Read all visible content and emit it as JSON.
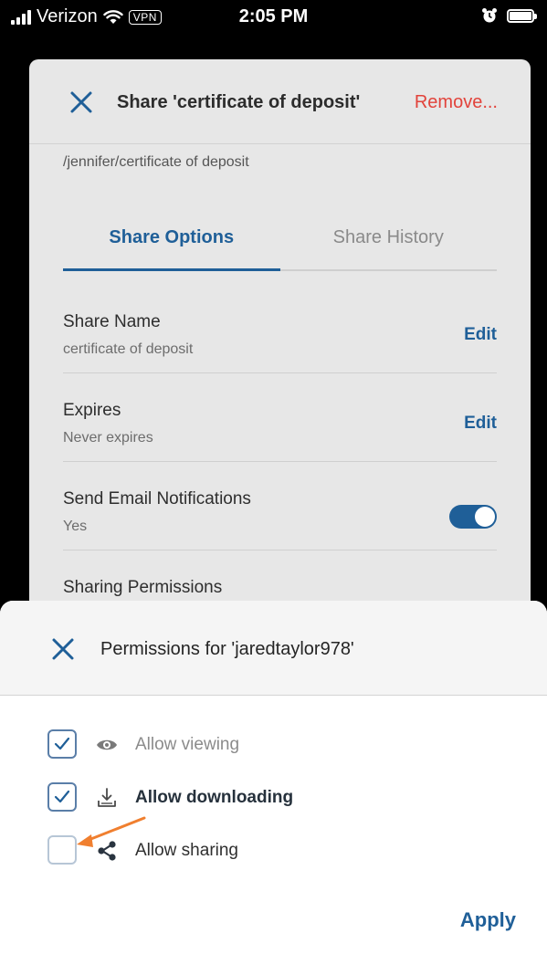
{
  "status_bar": {
    "carrier": "Verizon",
    "vpn": "VPN",
    "time": "2:05 PM"
  },
  "share_modal": {
    "title": "Share 'certificate of deposit'",
    "remove_label": "Remove...",
    "path": "/jennifer/certificate of deposit",
    "tabs": [
      {
        "label": "Share Options",
        "active": true
      },
      {
        "label": "Share History",
        "active": false
      }
    ],
    "options": [
      {
        "label": "Share Name",
        "value": "certificate of deposit",
        "action": "Edit"
      },
      {
        "label": "Expires",
        "value": "Never expires",
        "action": "Edit"
      },
      {
        "label": "Send Email Notifications",
        "value": "Yes",
        "toggle_on": true
      },
      {
        "label": "Sharing Permissions"
      }
    ]
  },
  "permissions_sheet": {
    "title": "Permissions for 'jaredtaylor978'",
    "permissions": [
      {
        "label": "Allow viewing",
        "checked": true,
        "icon": "eye-icon"
      },
      {
        "label": "Allow downloading",
        "checked": true,
        "icon": "download-icon"
      },
      {
        "label": "Allow sharing",
        "checked": false,
        "icon": "share-icon"
      }
    ],
    "apply_label": "Apply"
  },
  "colors": {
    "accent": "#1f5f98",
    "danger": "#e2433b",
    "annotation_arrow": "#f07f2f"
  }
}
